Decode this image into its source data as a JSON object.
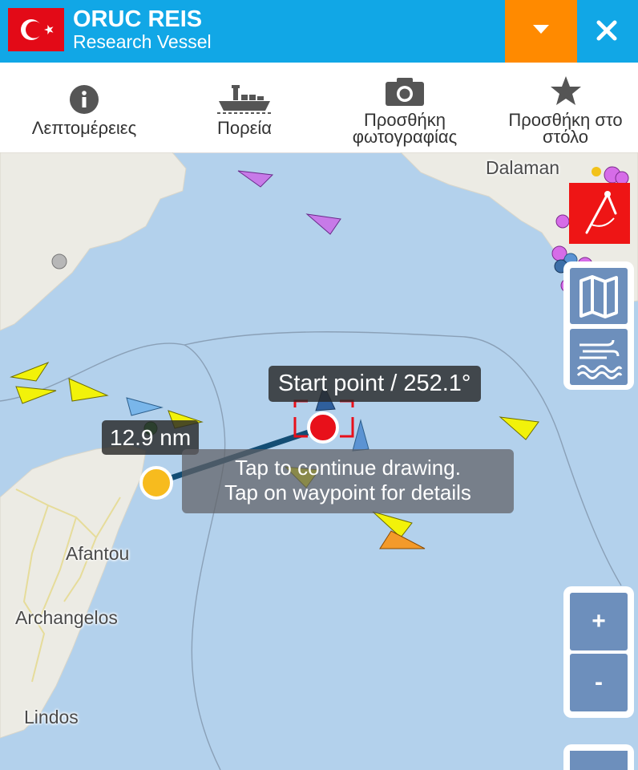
{
  "header": {
    "vessel_name": "ORUC REIS",
    "vessel_type": "Research Vessel",
    "flag_icon": "turkey-flag-icon",
    "dropdown_icon": "chevron-down-icon",
    "close_icon": "close-icon",
    "colors": {
      "header_bg": "#11a7e6",
      "dropdown_bg": "#ff8a00"
    }
  },
  "toolbar": {
    "details_label": "Λεπτομέρειες",
    "route_label": "Πορεία",
    "add_photo_label_1": "Προσθήκη",
    "add_photo_label_2": "φωτογραφίας",
    "add_fleet_label_1": "Προσθήκη στο",
    "add_fleet_label_2": "στόλο"
  },
  "map": {
    "places": {
      "dalaman": "Dalaman",
      "afantou": "Afantou",
      "archangelos": "Archangelos",
      "lindos": "Lindos"
    },
    "measure": {
      "start_label": "Start point / 252.1°",
      "distance_label": "12.9 nm",
      "hint_line_1": "Tap to continue drawing.",
      "hint_line_2": "Tap on waypoint for details",
      "start_color": "#e8101a",
      "end_color": "#f7bb1e",
      "line_color": "#134d74"
    },
    "controls": {
      "measure_icon": "compass-measure-icon",
      "map_layers_icon": "map-icon",
      "weather_icon": "wind-waves-icon",
      "zoom_in": "+",
      "zoom_out": "-"
    }
  }
}
